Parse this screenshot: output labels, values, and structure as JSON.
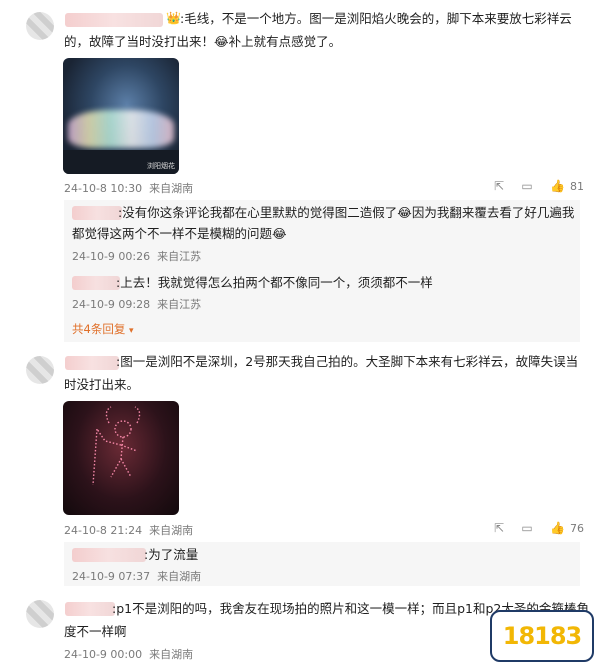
{
  "comments": [
    {
      "text_line1": ":毛线，不是一个地方。图一是浏阳焰火晚会的，脚下本来要放七彩祥云",
      "text_line2": "的，故障了当时没打出来！😂补上就有点感觉了。",
      "date": "24-10-8 10:30",
      "location": "来自湖南",
      "likes": "81",
      "replies": [
        {
          "text_line1": ":没有你这条评论我都在心里默默的觉得图二造假了😂因为我翻来覆去看了好几遍我",
          "text_line2": "都觉得这两个不一样不是模糊的问题😂",
          "date": "24-10-9 00:26",
          "location": "来自江苏"
        },
        {
          "text_line1": ":上去！我就觉得怎么拍两个都不像同一个，须须都不一样",
          "date": "24-10-9 09:28",
          "location": "来自江苏"
        }
      ],
      "more_replies": "共4条回复"
    },
    {
      "text_line1": ":图一是浏阳不是深圳，2号那天我自己拍的。大圣脚下本来有七彩祥云，故障失误当",
      "text_line2": "时没打出来。",
      "date": "24-10-8 21:24",
      "location": "来自湖南",
      "likes": "76",
      "replies": [
        {
          "text_line1": ":为了流量",
          "date": "24-10-9 07:37",
          "location": "来自湖南"
        }
      ]
    },
    {
      "text_line1": ":p1不是浏阳的吗，我舍友在现场拍的照片和这一模一样；而且p1和p2大圣的金箍棒角",
      "text_line2": "度不一样啊",
      "date": "24-10-9 00:00",
      "location": "来自湖南"
    }
  ],
  "image_watermark": "浏阳烟花",
  "site_logo": "18183"
}
